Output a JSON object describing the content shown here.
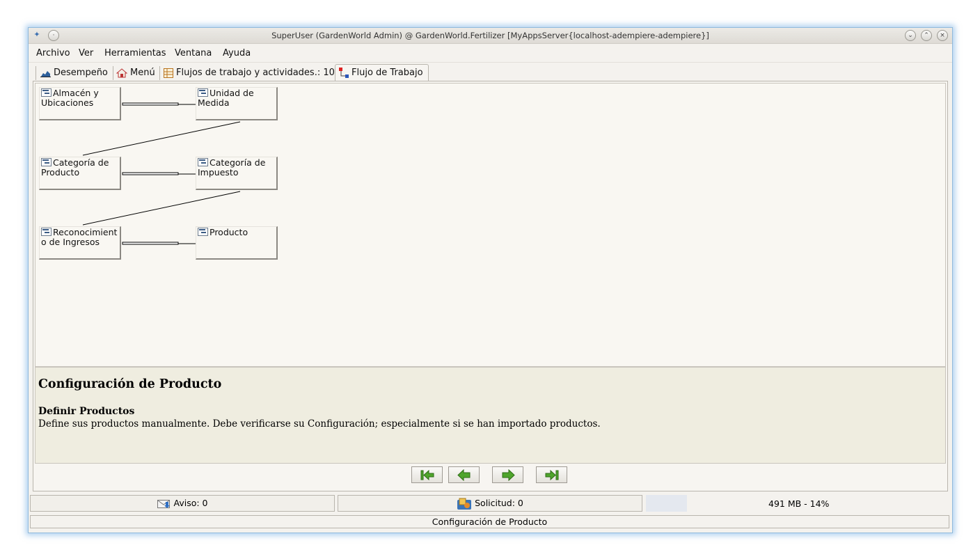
{
  "window": {
    "title": "SuperUser (GardenWorld Admin) @ GardenWorld.Fertilizer [MyAppsServer{localhost-adempiere-adempiere}]"
  },
  "menubar": {
    "items": [
      {
        "label": "Archivo"
      },
      {
        "label": "Ver"
      },
      {
        "label": "Herramientas"
      },
      {
        "label": "Ventana"
      },
      {
        "label": "Ayuda"
      }
    ]
  },
  "tabs": [
    {
      "label": "Desempeño",
      "icon": "chart-icon"
    },
    {
      "label": "Menú",
      "icon": "home-icon"
    },
    {
      "label": "Flujos de trabajo y actividades.: 10",
      "icon": "table-icon"
    },
    {
      "label": "Flujo de Trabajo",
      "icon": "workflow-icon",
      "active": true
    }
  ],
  "workflow": {
    "nodes": [
      {
        "label": "Almacén y Ubicaciones"
      },
      {
        "label": "Unidad de Medida"
      },
      {
        "label": "Categoría de Producto"
      },
      {
        "label": "Categoría de Impuesto"
      },
      {
        "label": "Reconocimiento de Ingresos"
      },
      {
        "label": "Producto"
      }
    ]
  },
  "description": {
    "title": "Configuración de Producto",
    "subtitle": "Definir Productos",
    "text": "Define sus productos manualmente. Debe verificarse su Configuración; especialmente si se han importado productos."
  },
  "navigation": {
    "buttons": [
      "first",
      "previous",
      "next",
      "last"
    ],
    "color": "#4fa52c"
  },
  "statusbar": {
    "notice": "Aviso: 0",
    "request": "Solicitud: 0",
    "memory": "491 MB - 14%"
  },
  "footer": {
    "text": "Configuración de Producto"
  }
}
